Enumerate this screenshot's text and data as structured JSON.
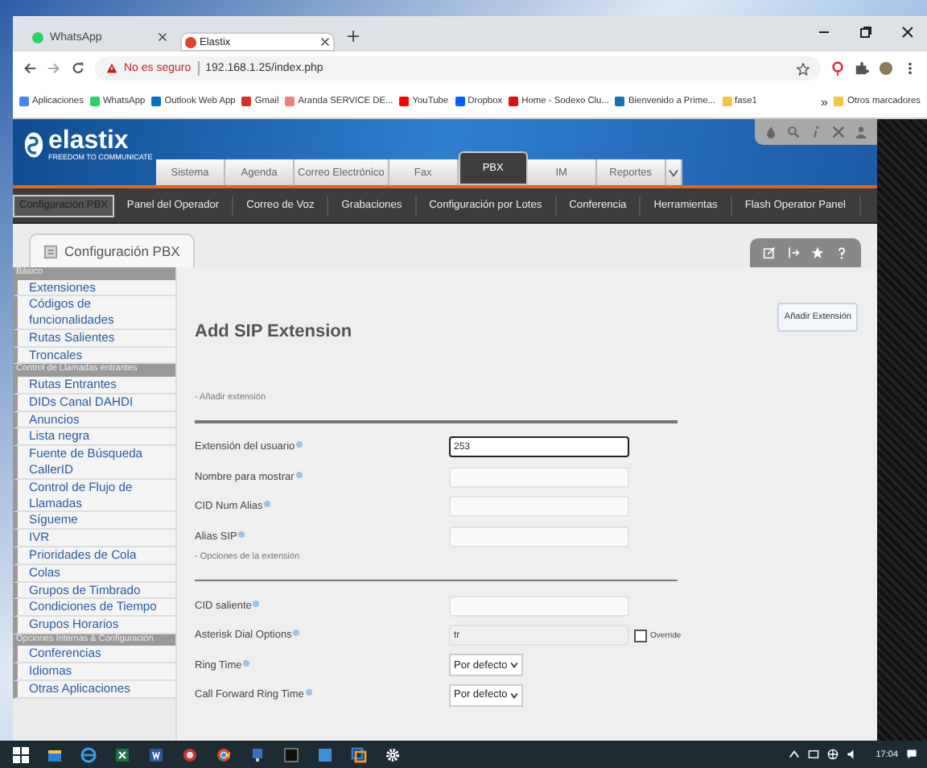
{
  "browser": {
    "tabs": [
      {
        "title": "WhatsApp",
        "selected": false,
        "color": "#25d366"
      },
      {
        "title": "Elastix",
        "selected": true,
        "color": "#e0452c"
      }
    ],
    "address": {
      "warning": "No es seguro",
      "url": "192.168.1.25/index.php"
    },
    "bookmarks": [
      {
        "label": "Aplicaciones",
        "color": "#4285f4"
      },
      {
        "label": "WhatsApp",
        "color": "#25d366"
      },
      {
        "label": "Outlook Web App",
        "color": "#0072c6"
      },
      {
        "label": "Gmail",
        "color": "#d93025"
      },
      {
        "label": "Aranda SERVICE DE...",
        "color": "#f08080"
      },
      {
        "label": "YouTube",
        "color": "#ff0000"
      },
      {
        "label": "Dropbox",
        "color": "#0061ff"
      },
      {
        "label": "Home - Sodexo Clu...",
        "color": "#e01010"
      },
      {
        "label": "Bienvenido a Prime...",
        "color": "#1a6fb5"
      },
      {
        "label": "fase1",
        "color": "#f4c542"
      }
    ],
    "more": "»",
    "other_bookmarks": "Otros marcadores"
  },
  "header": {
    "brand": "elastix",
    "tagline": "FREEDOM TO COMMUNICATE",
    "nav": [
      {
        "label": "Sistema",
        "selected": false
      },
      {
        "label": "Agenda",
        "selected": false
      },
      {
        "label": "Correo Electrónico",
        "selected": false
      },
      {
        "label": "Fax",
        "selected": false
      },
      {
        "label": "PBX",
        "selected": true
      },
      {
        "label": "IM",
        "selected": false
      },
      {
        "label": "Reportes",
        "selected": false
      }
    ],
    "subnav": [
      {
        "label": "Configuración PBX",
        "selected": true
      },
      {
        "label": "Panel del Operador",
        "selected": false
      },
      {
        "label": "Correo de Voz",
        "selected": false
      },
      {
        "label": "Grabaciones",
        "selected": false
      },
      {
        "label": "Configuración por Lotes",
        "selected": false
      },
      {
        "label": "Conferencia",
        "selected": false
      },
      {
        "label": "Herramientas",
        "selected": false
      },
      {
        "label": "Flash Operator Panel",
        "selected": false
      }
    ]
  },
  "panel_title": "Configuración PBX",
  "sidebar": [
    {
      "kind": "section",
      "label": "Básico"
    },
    {
      "kind": "item",
      "label": "Extensiones"
    },
    {
      "kind": "item",
      "label": "Códigos de funcionalidades"
    },
    {
      "kind": "item",
      "label": "Rutas Salientes"
    },
    {
      "kind": "item",
      "label": "Troncales"
    },
    {
      "kind": "section",
      "label": "Control de Llamadas entrantes"
    },
    {
      "kind": "item",
      "label": "Rutas Entrantes"
    },
    {
      "kind": "item",
      "label": "DIDs Canal DAHDI"
    },
    {
      "kind": "item",
      "label": "Anuncios"
    },
    {
      "kind": "item",
      "label": "Lista negra"
    },
    {
      "kind": "item",
      "label": "Fuente de Búsqueda CallerID"
    },
    {
      "kind": "item",
      "label": "Control de Flujo de Llamadas"
    },
    {
      "kind": "item",
      "label": "Sígueme"
    },
    {
      "kind": "item",
      "label": "IVR"
    },
    {
      "kind": "item",
      "label": "Prioridades de Cola"
    },
    {
      "kind": "item",
      "label": "Colas"
    },
    {
      "kind": "item",
      "label": "Grupos de Timbrado"
    },
    {
      "kind": "item",
      "label": "Condiciones de Tiempo"
    },
    {
      "kind": "item",
      "label": "Grupos Horarios"
    },
    {
      "kind": "section",
      "label": "Opciones Internas & Configuración"
    },
    {
      "kind": "item",
      "label": "Conferencias"
    },
    {
      "kind": "item",
      "label": "Idiomas"
    },
    {
      "kind": "item",
      "label": "Otras Aplicaciones"
    }
  ],
  "form": {
    "title": "Add SIP Extension",
    "add_button": "Añadir Extensión",
    "sections": [
      {
        "heading": "- Añadir extensión",
        "fields": [
          {
            "kind": "text",
            "label": "Extensión del usuario",
            "value": "253",
            "focused": true
          },
          {
            "kind": "text",
            "label": "Nombre para mostrar",
            "focused": false
          },
          {
            "kind": "text",
            "label": "CID Num Alias",
            "focused": false
          },
          {
            "kind": "text",
            "label": "Alias SIP",
            "focused": false
          }
        ]
      },
      {
        "heading": "- Opciones de la extensión",
        "fields": [
          {
            "kind": "text",
            "label": "CID saliente",
            "focused": false
          },
          {
            "kind": "readonly",
            "label": "Asterisk Dial Options",
            "value": "tr",
            "override": {
              "label": "Override",
              "checked": false
            }
          },
          {
            "kind": "select",
            "label": "Ring Time",
            "value": "Por defecto"
          },
          {
            "kind": "select",
            "label": "Call Forward Ring Time",
            "value": "Por defecto"
          }
        ]
      }
    ]
  },
  "taskbar": {
    "time": "17:04"
  }
}
